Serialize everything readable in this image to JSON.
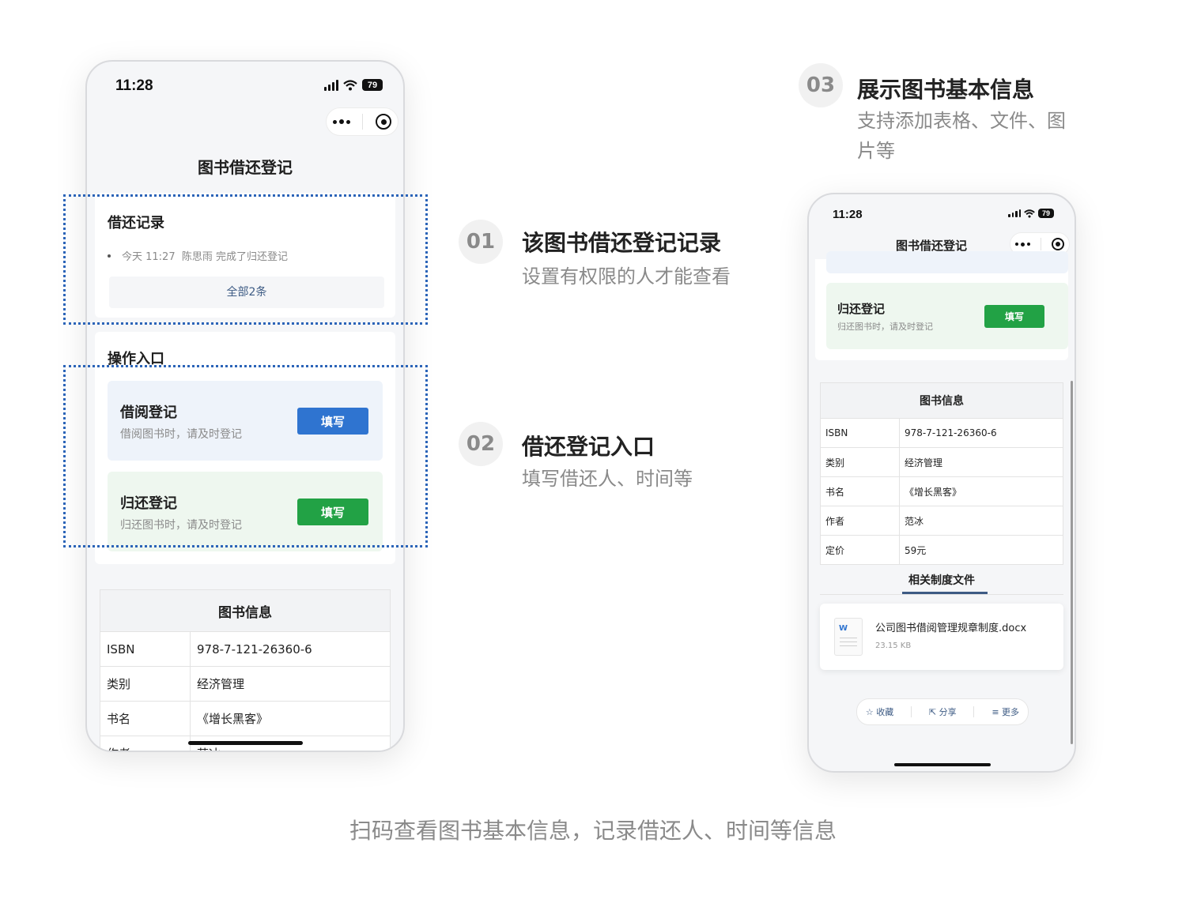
{
  "status_bar": {
    "time": "11:28",
    "battery": "79"
  },
  "page_title": "图书借还登记",
  "records": {
    "title": "借还记录",
    "items": [
      {
        "time": "今天 11:27",
        "user": "陈思雨",
        "action": "完成了归还登记"
      }
    ],
    "all_label": "全部2条"
  },
  "operations": {
    "title": "操作入口",
    "borrow": {
      "title": "借阅登记",
      "desc": "借阅图书时，请及时登记",
      "button": "填写",
      "color": "#2f74d0"
    },
    "return": {
      "title": "归还登记",
      "desc": "归还图书时，请及时登记",
      "button": "填写",
      "color": "#22a245"
    }
  },
  "book_info": {
    "title": "图书信息",
    "rows": [
      {
        "label": "ISBN",
        "value": "978-7-121-26360-6"
      },
      {
        "label": "类别",
        "value": "经济管理"
      },
      {
        "label": "书名",
        "value": "《增长黑客》"
      },
      {
        "label": "作者",
        "value": "范冰"
      },
      {
        "label": "定价",
        "value": "59元"
      }
    ]
  },
  "related": {
    "tab": "相关制度文件",
    "file_name": "公司图书借阅管理规章制度.docx",
    "file_size": "23.15 KB",
    "file_type": "W"
  },
  "bottom_actions": {
    "favorite": "收藏",
    "share": "分享",
    "more": "更多"
  },
  "annotations": [
    {
      "num": "01",
      "title": "该图书借还登记记录",
      "sub": "设置有权限的人才能查看"
    },
    {
      "num": "02",
      "title": "借还登记入口",
      "sub": "填写借还人、时间等"
    },
    {
      "num": "03",
      "title": "展示图书基本信息",
      "sub": "支持添加表格、文件、图片等"
    }
  ],
  "caption": "扫码查看图书基本信息，记录借还人、时间等信息",
  "colors": {
    "dotted_border": "#2b64b8",
    "tab_underline": "#3d5b84"
  }
}
